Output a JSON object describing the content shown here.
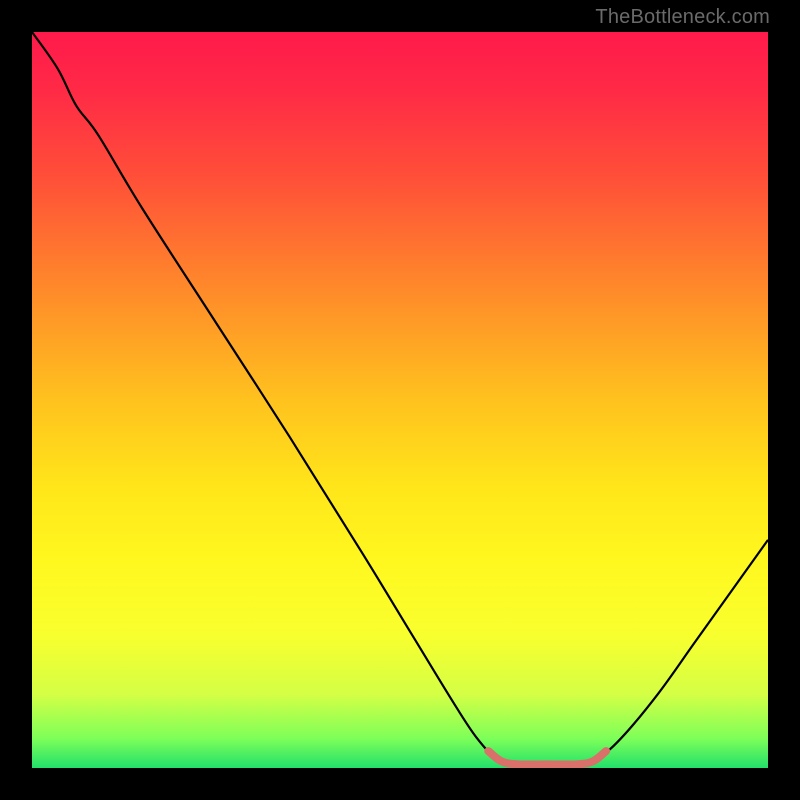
{
  "watermark": "TheBottleneck.com",
  "chart_data": {
    "type": "line",
    "title": "",
    "xlabel": "",
    "ylabel": "",
    "xlim": [
      0,
      100
    ],
    "ylim": [
      0,
      100
    ],
    "background_gradient": {
      "stops": [
        {
          "offset": 0.0,
          "color": "#ff1a4b"
        },
        {
          "offset": 0.08,
          "color": "#ff2a46"
        },
        {
          "offset": 0.2,
          "color": "#ff5038"
        },
        {
          "offset": 0.35,
          "color": "#ff8a2a"
        },
        {
          "offset": 0.5,
          "color": "#ffc21e"
        },
        {
          "offset": 0.62,
          "color": "#ffe61a"
        },
        {
          "offset": 0.72,
          "color": "#fff81f"
        },
        {
          "offset": 0.82,
          "color": "#f8ff2e"
        },
        {
          "offset": 0.9,
          "color": "#d4ff45"
        },
        {
          "offset": 0.96,
          "color": "#7dff59"
        },
        {
          "offset": 1.0,
          "color": "#22e06a"
        }
      ]
    },
    "series": [
      {
        "name": "bottleneck-curve",
        "stroke": "#000000",
        "width": 2.2,
        "points": [
          {
            "x": 0.0,
            "y": 100.0
          },
          {
            "x": 3.5,
            "y": 95.0
          },
          {
            "x": 6.0,
            "y": 90.0
          },
          {
            "x": 9.0,
            "y": 86.0
          },
          {
            "x": 15.0,
            "y": 76.0
          },
          {
            "x": 25.0,
            "y": 60.5
          },
          {
            "x": 35.0,
            "y": 45.0
          },
          {
            "x": 45.0,
            "y": 29.0
          },
          {
            "x": 52.0,
            "y": 17.5
          },
          {
            "x": 57.5,
            "y": 8.5
          },
          {
            "x": 60.5,
            "y": 4.0
          },
          {
            "x": 63.0,
            "y": 1.5
          },
          {
            "x": 66.0,
            "y": 0.5
          },
          {
            "x": 70.0,
            "y": 0.5
          },
          {
            "x": 74.0,
            "y": 0.5
          },
          {
            "x": 77.0,
            "y": 1.5
          },
          {
            "x": 80.0,
            "y": 4.0
          },
          {
            "x": 85.0,
            "y": 10.0
          },
          {
            "x": 90.0,
            "y": 17.0
          },
          {
            "x": 95.0,
            "y": 24.0
          },
          {
            "x": 100.0,
            "y": 31.0
          }
        ]
      },
      {
        "name": "optimal-zone-highlight",
        "stroke": "#d9706a",
        "width": 8,
        "points": [
          {
            "x": 62.0,
            "y": 2.3
          },
          {
            "x": 63.8,
            "y": 0.9
          },
          {
            "x": 66.0,
            "y": 0.5
          },
          {
            "x": 70.0,
            "y": 0.5
          },
          {
            "x": 74.0,
            "y": 0.5
          },
          {
            "x": 76.2,
            "y": 0.9
          },
          {
            "x": 78.0,
            "y": 2.3
          }
        ]
      }
    ]
  }
}
